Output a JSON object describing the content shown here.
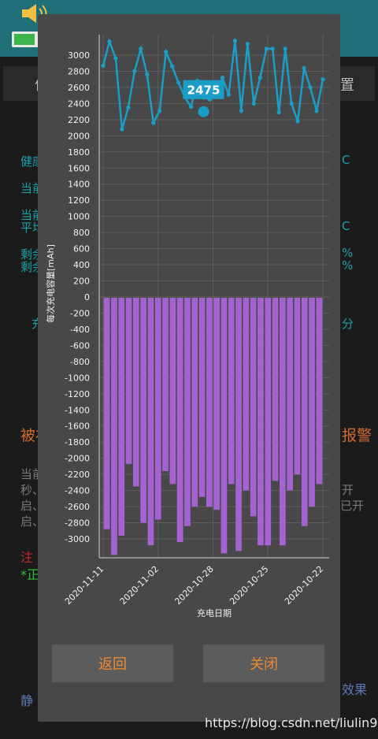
{
  "watermark": "https://blog.csdn.net/liulin900",
  "background": {
    "tab_left_char": "信",
    "tab_right_char": "置",
    "rows": [
      {
        "left": "健康",
        "right": "C"
      },
      {
        "left": "当前",
        "right": ""
      },
      {
        "left": "当前",
        "right": ""
      },
      {
        "left": "平均",
        "right": "C"
      },
      {
        "left": "剩余",
        "right": "%"
      },
      {
        "left": "剩余",
        "right": "%"
      },
      {
        "left": "充",
        "right": "分"
      }
    ],
    "alert_left": "被补",
    "alert_right": "报警",
    "para_left": [
      "当前",
      "秒、",
      "启、",
      "启、"
    ],
    "para_right": [
      "",
      "开",
      "已开",
      ""
    ],
    "note_red": "注",
    "note_green": "*正",
    "footer_left": "静",
    "footer_right": "效果"
  },
  "dialog": {
    "back_label": "返回",
    "close_label": "关闭"
  },
  "chart_data": {
    "type": "bar+line",
    "ylabel": "每次充电容量[mAh]",
    "xlabel": "充电日期",
    "ylim": [
      -3200,
      3300
    ],
    "yticks": [
      3000,
      2800,
      2600,
      2400,
      2200,
      2000,
      1800,
      1600,
      1400,
      1200,
      1000,
      800,
      600,
      400,
      200,
      0,
      -200,
      -400,
      -600,
      -800,
      -1000,
      -1200,
      -1400,
      -1600,
      -1800,
      -2000,
      -2200,
      -2400,
      -2600,
      -2800,
      -3000
    ],
    "xtick_labels": [
      {
        "index": 0,
        "label": "2020-11-11"
      },
      {
        "index": 10,
        "label": "2020-11-02"
      },
      {
        "index": 20,
        "label": "2020-10-28"
      },
      {
        "index": 30,
        "label": "2020-10-25"
      },
      {
        "index": 40,
        "label": "2020-10-22"
      }
    ],
    "highlight": {
      "index": 18,
      "label": "2475"
    },
    "line_values": [
      2870,
      3170,
      2960,
      2080,
      2350,
      2800,
      3080,
      2760,
      2160,
      2310,
      3040,
      2860,
      2660,
      2480,
      2360,
      2680,
      2475,
      2450,
      2500,
      2720,
      2510,
      3180,
      2310,
      3140,
      2400,
      2720,
      3080,
      3080,
      2290,
      3080,
      2400,
      2180,
      2840,
      2600,
      2310,
      2700
    ],
    "bar_values": [
      -2880,
      -3200,
      -2960,
      -2070,
      -2350,
      -2800,
      -3080,
      -2760,
      -2160,
      -2320,
      -3040,
      -2840,
      -2600,
      -2480,
      -2600,
      -2640,
      -3180,
      -2320,
      -3150,
      -2400,
      -2720,
      -3080,
      -3080,
      -2280,
      -3080,
      -2400,
      -2200,
      -2840,
      -2600,
      -2320
    ]
  }
}
